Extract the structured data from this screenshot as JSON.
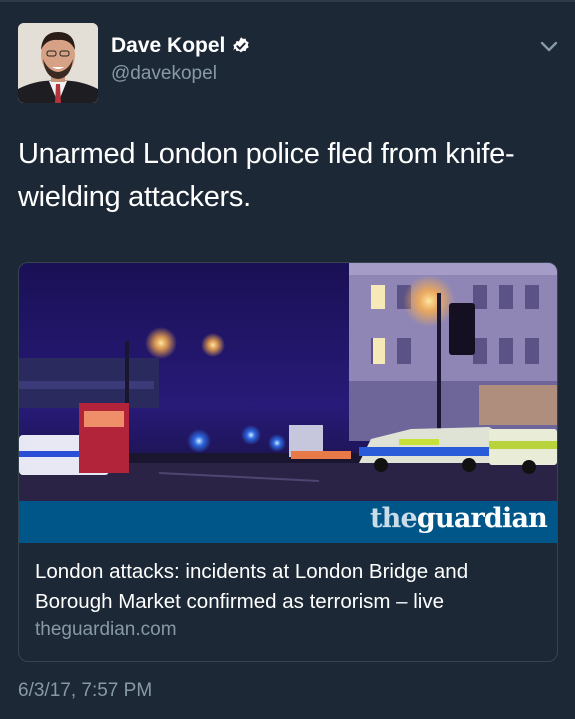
{
  "author": {
    "name": "Dave Kopel",
    "handle": "@davekopel",
    "verified": true
  },
  "tweet": {
    "text": "Unarmed London police fled from knife-wielding attackers.",
    "timestamp": "6/3/17, 7:57 PM"
  },
  "link_card": {
    "logo_the": "the",
    "logo_guardian": "guardian",
    "title": "London attacks: incidents at London Bridge and Borough Market confirmed as terrorism – live",
    "domain": "theguardian.com"
  },
  "colors": {
    "background": "#1c2836",
    "secondary_text": "#8899a6",
    "guardian_blue": "#005689",
    "verified_badge": "#ffffff"
  },
  "icons": [
    "verified-badge-icon",
    "chevron-down-icon"
  ]
}
